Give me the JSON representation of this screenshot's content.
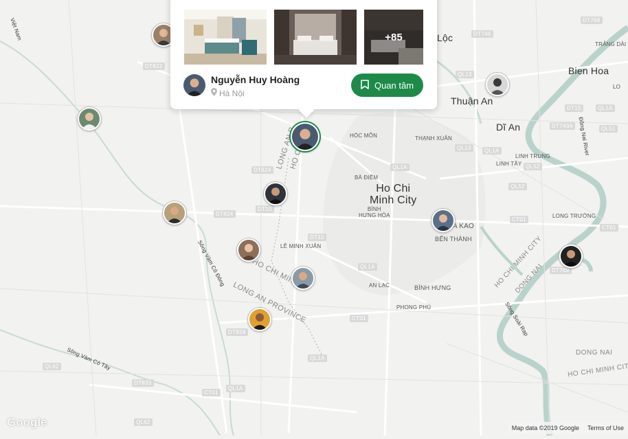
{
  "map": {
    "labels": {
      "viet_nam": "Việt Nam",
      "ho_chi_minh_city": "Ho Chi\nMinh City",
      "thuan_an": "Thuận An",
      "di_an": "Dĩ An",
      "bien_hoa": "Bien Hoa",
      "hoc_mon": "HÓC MÔN",
      "thanh_xuan": "THẠNH XUÂN",
      "linh_trung": "LINH TRUNG",
      "linh_tay": "LINH TÂY",
      "ba_diem": "BÀ ĐIỂM",
      "binh_hung_hoa": "BÌNH\nHƯNG HÒA",
      "da_kao": "A KAO",
      "ben_thanh": "BẾN THÀNH",
      "le_minh_xuan": "LÊ MINH XUÂN",
      "an_lac": "AN LẠC",
      "binh_hung": "BÌNH HƯNG",
      "phong_phu": "PHONG PHÚ",
      "long_truong": "LONG TRƯỜNG",
      "trang_dai": "TRẢNG DÀI",
      "long_an_province": "LONG AN PROVINCE",
      "long_an_p": "LONG AN P",
      "ho_chi_m": "HO CHI M",
      "ho_chi_minh_c": "HO CHI MINH C",
      "ho_chi_minh_city_river": "HO CHI MINH CITY",
      "dong_nai": "DONG NAI",
      "dong_nai_2": "DONG NAI",
      "ho_chi_minh_cit": "HO CHI MINH CIT",
      "dong_nai_river": "Đồng Nai River",
      "song_vam_co_dong": "Sông Vàm Cỏ Đông",
      "song_vam_co_tay": "Sông Vàm Cỏ Tây",
      "song_soai_rap": "Sông Soài Rạp",
      "loc": "Lộc",
      "lo": "LO"
    },
    "shields": {
      "dt822": "DT822",
      "dt746": "DT746",
      "dt768": "DT768",
      "ql13a": "QL13",
      "ql13b": "QL13",
      "ql1a_a": "QL1A",
      "ql1a_b": "QL1A",
      "ql1a_c": "QL1A",
      "ql1a_d": "QL1A",
      "ql1a_e": "QL1A",
      "ql1a_f": "QL1A",
      "dt15": "DT15",
      "dt743a": "DT743A",
      "ql51": "QL51",
      "ql52a": "QL52",
      "ql52b": "QL52",
      "dt824a": "DT824",
      "dt824b": "DT824",
      "dt824c": "DT824",
      "dt10a": "DT10",
      "dt10b": "DT10",
      "ct01a": "CT01",
      "ct01b": "CT01",
      "ct01c": "CT01",
      "ct01d": "CT01",
      "dt769": "DT769",
      "ql62a": "QL62",
      "ql62b": "QL62",
      "dt833": "DT833"
    },
    "google_logo": "Google",
    "map_data": "Map data ©2019 Google",
    "terms": "Terms of Use"
  },
  "popup": {
    "photos_more": "+85",
    "host_name": "Nguyễn Huy Hoàng",
    "host_location": "Hà Nội",
    "follow_label": "Quan tâm"
  },
  "colors": {
    "accent": "#1e8a4a",
    "water": "#b9d3cc",
    "land": "#f2f2f0",
    "road": "#ffffff"
  }
}
